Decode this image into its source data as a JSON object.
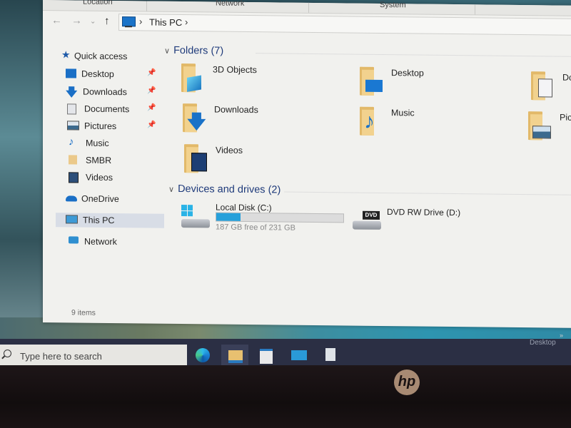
{
  "ribbon": {
    "tabs": [
      "Location",
      "Network",
      "System"
    ]
  },
  "navigation": {
    "back_icon": "arrow-left",
    "forward_icon": "arrow-right",
    "recent_icon": "chevron-down",
    "up_icon": "arrow-up",
    "breadcrumb": [
      "This PC"
    ]
  },
  "sidebar": {
    "quick_access": "Quick access",
    "items": [
      {
        "label": "Desktop",
        "icon": "desktop-icon",
        "pinned": true
      },
      {
        "label": "Downloads",
        "icon": "download-icon",
        "pinned": true
      },
      {
        "label": "Documents",
        "icon": "documents-icon",
        "pinned": true
      },
      {
        "label": "Pictures",
        "icon": "pictures-icon",
        "pinned": true
      },
      {
        "label": "Music",
        "icon": "music-icon",
        "pinned": false
      },
      {
        "label": "SMBR",
        "icon": "folder-icon",
        "pinned": false
      },
      {
        "label": "Videos",
        "icon": "videos-icon",
        "pinned": false
      }
    ],
    "onedrive": "OneDrive",
    "this_pc": "This PC",
    "network": "Network",
    "selected": "This PC"
  },
  "status": {
    "items_count": "9 items"
  },
  "content": {
    "folders_header": "Folders (7)",
    "folders": [
      {
        "name": "3D Objects",
        "icon": "3d-objects-icon"
      },
      {
        "name": "Desktop",
        "icon": "desktop-icon"
      },
      {
        "name": "Documents",
        "icon": "documents-icon"
      },
      {
        "name": "Downloads",
        "icon": "download-icon"
      },
      {
        "name": "Music",
        "icon": "music-icon"
      },
      {
        "name": "Pictures",
        "icon": "pictures-icon"
      },
      {
        "name": "Videos",
        "icon": "videos-icon"
      }
    ],
    "devices_header": "Devices and drives (2)",
    "drives": [
      {
        "name": "Local Disk (C:)",
        "free_text": "187 GB free of 231 GB",
        "used_fraction": 0.19
      },
      {
        "name": "DVD RW Drive (D:)",
        "badge": "DVD"
      }
    ]
  },
  "taskbar": {
    "search_placeholder": "Type here to search",
    "apps": [
      "Microsoft Edge",
      "File Explorer",
      "Microsoft Store",
      "Mail",
      "Photos"
    ],
    "active_app": "File Explorer",
    "desktop_label": "Desktop",
    "overflow_icon": "chevron-double-right"
  },
  "hardware": {
    "logo_text": "hp"
  },
  "colors": {
    "accent": "#26a0da",
    "folder_yellow": "#f2d28e",
    "header_blue": "#1e3a7a",
    "taskbar": "#2b2f44"
  }
}
